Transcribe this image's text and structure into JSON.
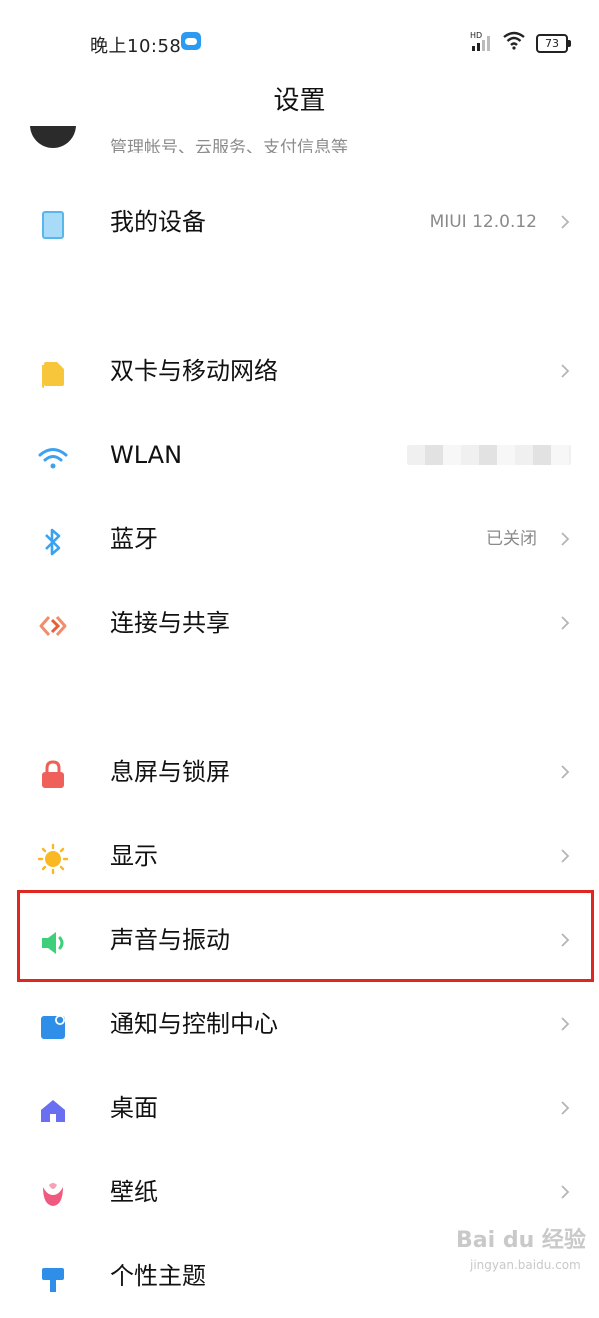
{
  "status_bar": {
    "time": "晚上10:58",
    "battery": "73"
  },
  "header": {
    "title": "设置"
  },
  "account": {
    "subtitle": "管理帐号、云服务、支付信息等"
  },
  "rows": [
    {
      "label": "我的设备",
      "value": "MIUI 12.0.12",
      "icon": "device-icon"
    },
    {
      "label": "双卡与移动网络",
      "value": "",
      "icon": "sim-icon"
    },
    {
      "label": "WLAN",
      "value": "",
      "icon": "wifi-icon"
    },
    {
      "label": "蓝牙",
      "value": "已关闭",
      "icon": "bluetooth-icon"
    },
    {
      "label": "连接与共享",
      "value": "",
      "icon": "share-icon"
    },
    {
      "label": "息屏与锁屏",
      "value": "",
      "icon": "lock-icon"
    },
    {
      "label": "显示",
      "value": "",
      "icon": "sun-icon"
    },
    {
      "label": "声音与振动",
      "value": "",
      "icon": "speaker-icon"
    },
    {
      "label": "通知与控制中心",
      "value": "",
      "icon": "notification-icon"
    },
    {
      "label": "桌面",
      "value": "",
      "icon": "home-icon"
    },
    {
      "label": "壁纸",
      "value": "",
      "icon": "flower-icon"
    },
    {
      "label": "个性主题",
      "value": "",
      "icon": "theme-icon"
    }
  ],
  "colors": {
    "highlight": "#e0271f",
    "accent": "#2a9af3"
  },
  "watermark": {
    "text": "Bai du 经验",
    "sub": "jingyan.baidu.com"
  }
}
